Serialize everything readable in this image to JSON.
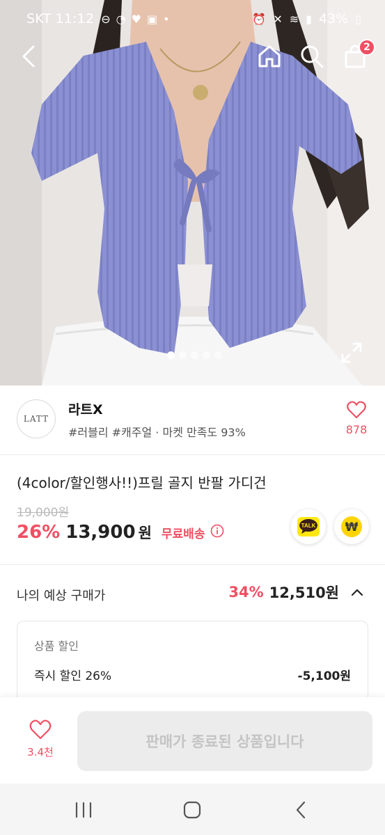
{
  "status_bar": {
    "carrier_time": "SKT 11:12",
    "battery": "43%"
  },
  "header": {
    "cart_count": "2"
  },
  "gallery": {
    "page_count": 5,
    "active_index": 0
  },
  "store": {
    "logo_text": "LATT",
    "name": "라트X",
    "tags": "#러블리 #캐주얼 · 마켓 만족도 93%",
    "like_count": "878"
  },
  "product": {
    "title": "(4color/할인행사!!)프릴 골지 반팔 가디건",
    "original_price": "19,000원",
    "discount_rate": "26%",
    "price": "13,900",
    "currency": "원",
    "shipping": "무료배송",
    "talk_label": "TALK",
    "pay_label": "₩"
  },
  "expected": {
    "label": "나의 예상 구매가",
    "rate": "34%",
    "price": "12,510원",
    "section": "상품 할인",
    "discount_label": "즉시 할인 26%",
    "discount_amount": "-5,100원"
  },
  "actions": {
    "wish_count": "3.4천",
    "soldout_label": "판매가 종료된 상품입니다"
  },
  "colors": {
    "accent": "#f04f63",
    "kakao_yellow": "#ffe812",
    "sweater": "#8a8fd0"
  }
}
